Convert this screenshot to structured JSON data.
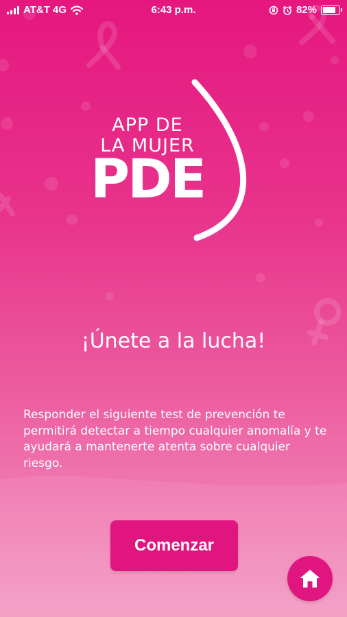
{
  "status_bar": {
    "carrier": "AT&T 4G",
    "time": "6:43 p.m.",
    "battery_text": "82%",
    "battery_level": 0.82
  },
  "logo": {
    "line1": "APP DE",
    "line2": "LA MUJER",
    "brand": "PDE"
  },
  "headline": "¡Únete a la lucha!",
  "description": "Responder el siguiente test de prevención te permitirá detectar a tiempo cualquier anomalía y te ayudará a mantenerte atenta sobre cualquier riesgo.",
  "actions": {
    "start_label": "Comenzar",
    "home_icon": "home-icon"
  },
  "colors": {
    "background_top": "#e5177f",
    "background_bottom": "#f39ac2",
    "button": "#e0157f",
    "text": "#ffffff"
  }
}
